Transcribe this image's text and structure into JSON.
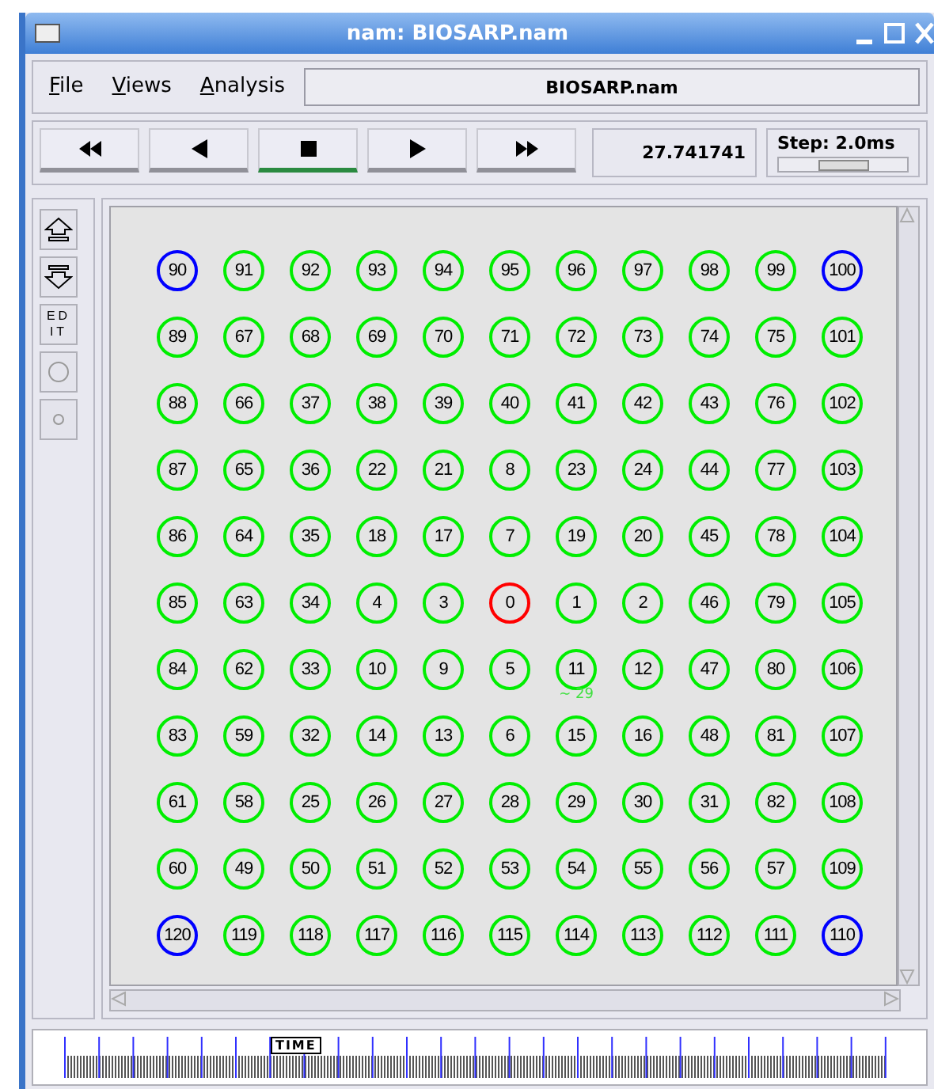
{
  "window": {
    "title": "nam: BIOSARP.nam"
  },
  "menu": [
    {
      "label": "File"
    },
    {
      "label": "Views"
    },
    {
      "label": "Analysis"
    }
  ],
  "file_label": "BIOSARP.nam",
  "transport": [
    {
      "kind": "rewind",
      "selected": false
    },
    {
      "kind": "back",
      "selected": false
    },
    {
      "kind": "stop",
      "selected": true
    },
    {
      "kind": "play",
      "selected": false
    },
    {
      "kind": "forward",
      "selected": false
    }
  ],
  "time": "27.741741",
  "step": {
    "label": "Step: 2.0ms",
    "level": 0.5
  },
  "tools": [
    {
      "kind": "zoom-in"
    },
    {
      "kind": "zoom-out"
    },
    {
      "kind": "edit",
      "label": "EDIT"
    },
    {
      "kind": "circle-large"
    },
    {
      "kind": "circle-small"
    }
  ],
  "nodes": [
    [
      {
        "label": "90",
        "color": "#0000ff"
      },
      {
        "label": "91",
        "color": "#00ee00"
      },
      {
        "label": "92",
        "color": "#00ee00"
      },
      {
        "label": "93",
        "color": "#00ee00"
      },
      {
        "label": "94",
        "color": "#00ee00"
      },
      {
        "label": "95",
        "color": "#00ee00"
      },
      {
        "label": "96",
        "color": "#00ee00"
      },
      {
        "label": "97",
        "color": "#00ee00"
      },
      {
        "label": "98",
        "color": "#00ee00"
      },
      {
        "label": "99",
        "color": "#00ee00"
      },
      {
        "label": "100",
        "color": "#0000ff"
      }
    ],
    [
      {
        "label": "89",
        "color": "#00ee00"
      },
      {
        "label": "67",
        "color": "#00ee00"
      },
      {
        "label": "68",
        "color": "#00ee00"
      },
      {
        "label": "69",
        "color": "#00ee00"
      },
      {
        "label": "70",
        "color": "#00ee00"
      },
      {
        "label": "71",
        "color": "#00ee00"
      },
      {
        "label": "72",
        "color": "#00ee00"
      },
      {
        "label": "73",
        "color": "#00ee00"
      },
      {
        "label": "74",
        "color": "#00ee00"
      },
      {
        "label": "75",
        "color": "#00ee00"
      },
      {
        "label": "101",
        "color": "#00ee00"
      }
    ],
    [
      {
        "label": "88",
        "color": "#00ee00"
      },
      {
        "label": "66",
        "color": "#00ee00"
      },
      {
        "label": "37",
        "color": "#00ee00"
      },
      {
        "label": "38",
        "color": "#00ee00"
      },
      {
        "label": "39",
        "color": "#00ee00"
      },
      {
        "label": "40",
        "color": "#00ee00"
      },
      {
        "label": "41",
        "color": "#00ee00"
      },
      {
        "label": "42",
        "color": "#00ee00"
      },
      {
        "label": "43",
        "color": "#00ee00"
      },
      {
        "label": "76",
        "color": "#00ee00"
      },
      {
        "label": "102",
        "color": "#00ee00"
      }
    ],
    [
      {
        "label": "87",
        "color": "#00ee00"
      },
      {
        "label": "65",
        "color": "#00ee00"
      },
      {
        "label": "36",
        "color": "#00ee00"
      },
      {
        "label": "22",
        "color": "#00ee00"
      },
      {
        "label": "21",
        "color": "#00ee00"
      },
      {
        "label": "8",
        "color": "#00ee00"
      },
      {
        "label": "23",
        "color": "#00ee00"
      },
      {
        "label": "24",
        "color": "#00ee00"
      },
      {
        "label": "44",
        "color": "#00ee00"
      },
      {
        "label": "77",
        "color": "#00ee00"
      },
      {
        "label": "103",
        "color": "#00ee00"
      }
    ],
    [
      {
        "label": "86",
        "color": "#00ee00"
      },
      {
        "label": "64",
        "color": "#00ee00"
      },
      {
        "label": "35",
        "color": "#00ee00"
      },
      {
        "label": "18",
        "color": "#00ee00"
      },
      {
        "label": "17",
        "color": "#00ee00"
      },
      {
        "label": "7",
        "color": "#00ee00"
      },
      {
        "label": "19",
        "color": "#00ee00"
      },
      {
        "label": "20",
        "color": "#00ee00"
      },
      {
        "label": "45",
        "color": "#00ee00"
      },
      {
        "label": "78",
        "color": "#00ee00"
      },
      {
        "label": "104",
        "color": "#00ee00"
      }
    ],
    [
      {
        "label": "85",
        "color": "#00ee00"
      },
      {
        "label": "63",
        "color": "#00ee00"
      },
      {
        "label": "34",
        "color": "#00ee00"
      },
      {
        "label": "4",
        "color": "#00ee00"
      },
      {
        "label": "3",
        "color": "#00ee00"
      },
      {
        "label": "0",
        "color": "#ff0000"
      },
      {
        "label": "1",
        "color": "#00ee00"
      },
      {
        "label": "2",
        "color": "#00ee00"
      },
      {
        "label": "46",
        "color": "#00ee00"
      },
      {
        "label": "79",
        "color": "#00ee00"
      },
      {
        "label": "105",
        "color": "#00ee00"
      }
    ],
    [
      {
        "label": "84",
        "color": "#00ee00"
      },
      {
        "label": "62",
        "color": "#00ee00"
      },
      {
        "label": "33",
        "color": "#00ee00"
      },
      {
        "label": "10",
        "color": "#00ee00"
      },
      {
        "label": "9",
        "color": "#00ee00"
      },
      {
        "label": "5",
        "color": "#00ee00"
      },
      {
        "label": "11",
        "color": "#00ee00",
        "annotation": "~ 29"
      },
      {
        "label": "12",
        "color": "#00ee00"
      },
      {
        "label": "47",
        "color": "#00ee00"
      },
      {
        "label": "80",
        "color": "#00ee00"
      },
      {
        "label": "106",
        "color": "#00ee00"
      }
    ],
    [
      {
        "label": "83",
        "color": "#00ee00"
      },
      {
        "label": "59",
        "color": "#00ee00"
      },
      {
        "label": "32",
        "color": "#00ee00"
      },
      {
        "label": "14",
        "color": "#00ee00"
      },
      {
        "label": "13",
        "color": "#00ee00"
      },
      {
        "label": "6",
        "color": "#00ee00"
      },
      {
        "label": "15",
        "color": "#00ee00"
      },
      {
        "label": "16",
        "color": "#00ee00"
      },
      {
        "label": "48",
        "color": "#00ee00"
      },
      {
        "label": "81",
        "color": "#00ee00"
      },
      {
        "label": "107",
        "color": "#00ee00"
      }
    ],
    [
      {
        "label": "61",
        "color": "#00ee00"
      },
      {
        "label": "58",
        "color": "#00ee00"
      },
      {
        "label": "25",
        "color": "#00ee00"
      },
      {
        "label": "26",
        "color": "#00ee00"
      },
      {
        "label": "27",
        "color": "#00ee00"
      },
      {
        "label": "28",
        "color": "#00ee00"
      },
      {
        "label": "29",
        "color": "#00ee00"
      },
      {
        "label": "30",
        "color": "#00ee00"
      },
      {
        "label": "31",
        "color": "#00ee00"
      },
      {
        "label": "82",
        "color": "#00ee00"
      },
      {
        "label": "108",
        "color": "#00ee00"
      }
    ],
    [
      {
        "label": "60",
        "color": "#00ee00"
      },
      {
        "label": "49",
        "color": "#00ee00"
      },
      {
        "label": "50",
        "color": "#00ee00"
      },
      {
        "label": "51",
        "color": "#00ee00"
      },
      {
        "label": "52",
        "color": "#00ee00"
      },
      {
        "label": "53",
        "color": "#00ee00"
      },
      {
        "label": "54",
        "color": "#00ee00"
      },
      {
        "label": "55",
        "color": "#00ee00"
      },
      {
        "label": "56",
        "color": "#00ee00"
      },
      {
        "label": "57",
        "color": "#00ee00"
      },
      {
        "label": "109",
        "color": "#00ee00"
      }
    ],
    [
      {
        "label": "120",
        "color": "#0000ff"
      },
      {
        "label": "119",
        "color": "#00ee00"
      },
      {
        "label": "118",
        "color": "#00ee00"
      },
      {
        "label": "117",
        "color": "#00ee00"
      },
      {
        "label": "116",
        "color": "#00ee00"
      },
      {
        "label": "115",
        "color": "#00ee00"
      },
      {
        "label": "114",
        "color": "#00ee00"
      },
      {
        "label": "113",
        "color": "#00ee00"
      },
      {
        "label": "112",
        "color": "#00ee00"
      },
      {
        "label": "111",
        "color": "#00ee00"
      },
      {
        "label": "110",
        "color": "#0000ff"
      }
    ]
  ],
  "timeline": {
    "label": "TIME"
  }
}
